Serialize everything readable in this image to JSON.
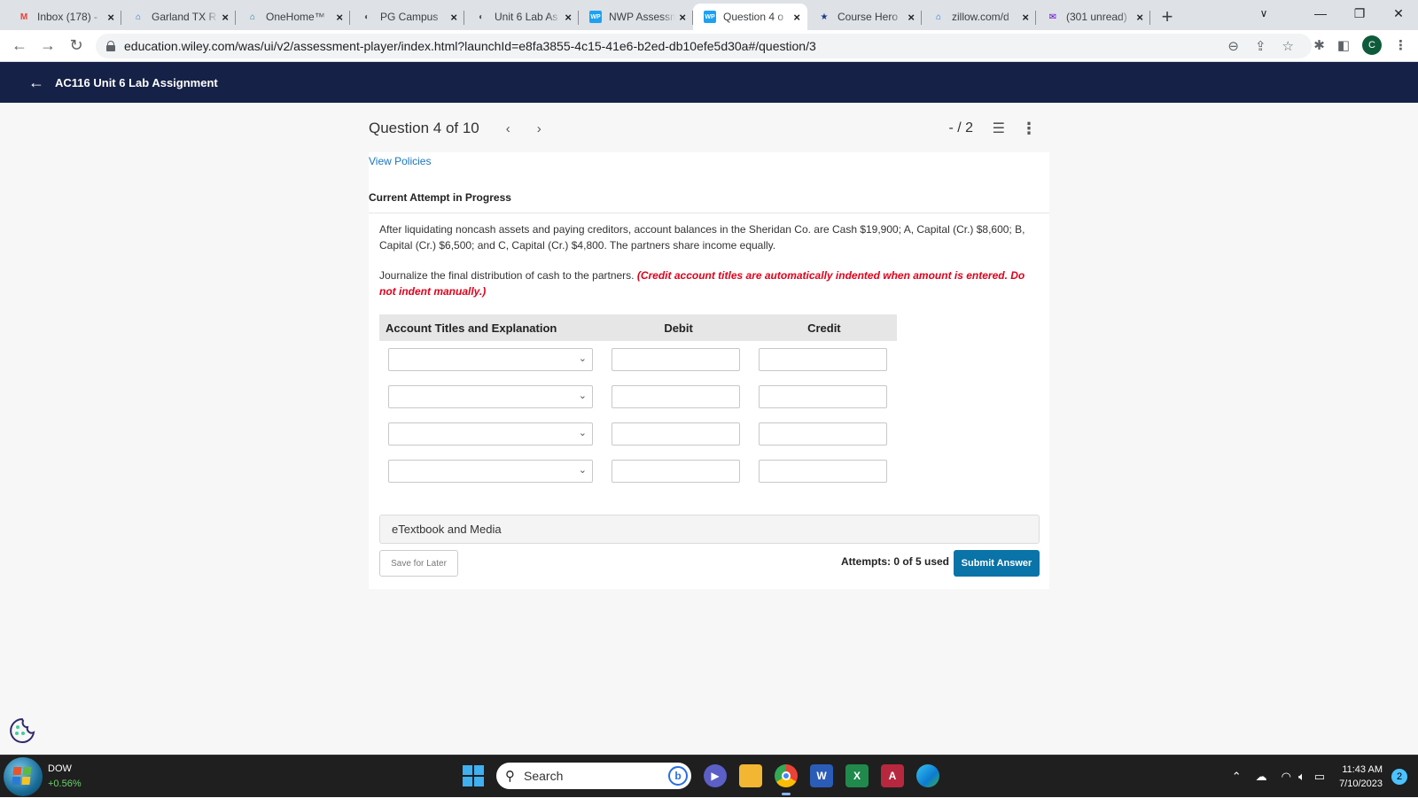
{
  "browser": {
    "tabs": [
      {
        "title": "Inbox (178) -",
        "icon": "gmail-icon",
        "icon_color": "#ea4335",
        "icon_glyph": "M"
      },
      {
        "title": "Garland TX R",
        "icon": "zillow-icon",
        "icon_color": "#1277e1",
        "icon_glyph": "⌂"
      },
      {
        "title": "OneHome™",
        "icon": "onehome-icon",
        "icon_color": "#1a7fa6",
        "icon_glyph": "⌂"
      },
      {
        "title": "PG Campus",
        "icon": "campus-icon",
        "icon_color": "#555555",
        "icon_glyph": "◐"
      },
      {
        "title": "Unit 6 Lab As",
        "icon": "campus-icon",
        "icon_color": "#555555",
        "icon_glyph": "◐"
      },
      {
        "title": "NWP Assessm",
        "icon": "wileyplus-icon",
        "icon_color": "#1da1f2",
        "icon_glyph": "WP"
      },
      {
        "title": "Question 4 o",
        "icon": "wileyplus-icon",
        "icon_color": "#1da1f2",
        "icon_glyph": "WP",
        "active": true
      },
      {
        "title": "Course Hero",
        "icon": "coursehero-icon",
        "icon_color": "#1a3a8a",
        "icon_glyph": "★"
      },
      {
        "title": "zillow.com/d",
        "icon": "zillow-icon",
        "icon_color": "#1277e1",
        "icon_glyph": "⌂"
      },
      {
        "title": "(301 unread)",
        "icon": "yahoo-mail-icon",
        "icon_color": "#6001d2",
        "icon_glyph": "✉"
      }
    ],
    "new_tab": "+",
    "url": "education.wiley.com/was/ui/v2/assessment-player/index.html?launchId=e8fa3855-4c15-41e6-b2ed-db10efe5d30a#/question/3",
    "profile_initial": "C"
  },
  "app": {
    "course_title": "AC116 Unit 6 Lab Assignment",
    "brand_color": "#152146"
  },
  "question": {
    "position": "Question 4 of 10",
    "prev": "‹",
    "next": "›",
    "score": "- / 2",
    "view_policies": "View Policies",
    "attempt_status": "Current Attempt in Progress",
    "text": "After liquidating noncash assets and paying creditors, account balances in the Sheridan Co. are Cash $19,900; A, Capital (Cr.) $8,600; B, Capital (Cr.) $6,500; and C, Capital (Cr.) $4,800. The partners share income equally.",
    "instruction": "Journalize the final distribution of cash to the partners.",
    "instruction_note": "(Credit account titles are automatically indented when amount is entered. Do not indent manually.)",
    "note_color": "#e1001a"
  },
  "journal": {
    "headers": [
      "Account Titles and Explanation",
      "Debit",
      "Credit"
    ],
    "rows": [
      {
        "account": "",
        "debit": "",
        "credit": ""
      },
      {
        "account": "",
        "debit": "",
        "credit": ""
      },
      {
        "account": "",
        "debit": "",
        "credit": ""
      },
      {
        "account": "",
        "debit": "",
        "credit": ""
      }
    ]
  },
  "footer": {
    "etextbook": "eTextbook and Media",
    "save_later": "Save for Later",
    "attempts": "Attempts: 0 of 5 used",
    "submit": "Submit Answer",
    "submit_color": "#0a73a7"
  },
  "taskbar": {
    "widget_name": "DOW",
    "widget_value": "+0.56%",
    "search_placeholder": "Search",
    "time": "11:43 AM",
    "date": "7/10/2023",
    "notifications": "2"
  }
}
